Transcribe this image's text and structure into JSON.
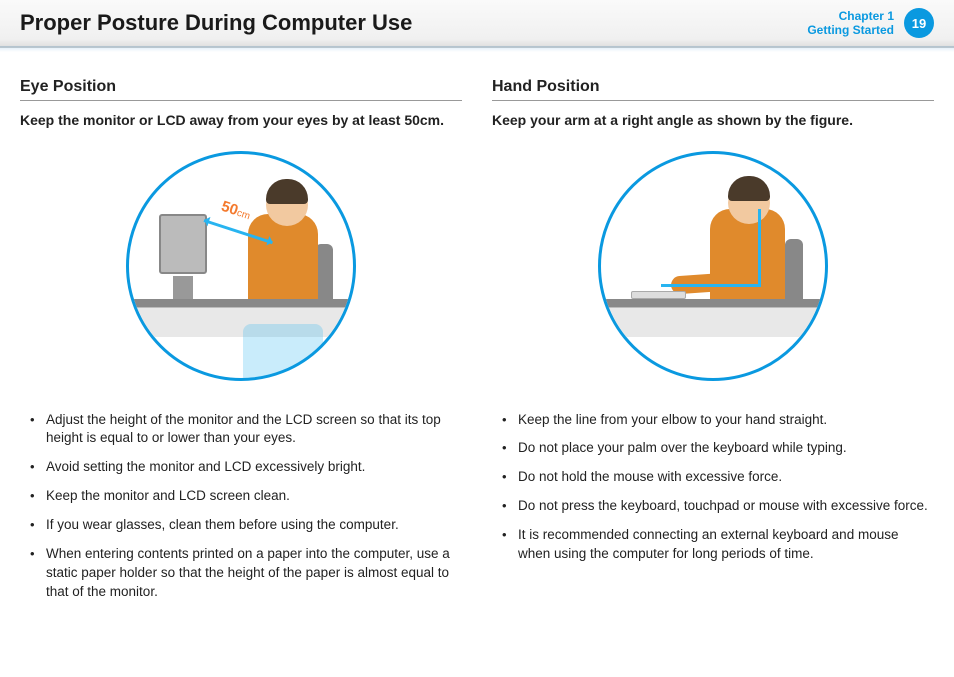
{
  "header": {
    "title": "Proper Posture During Computer Use",
    "chapter_line1": "Chapter 1",
    "chapter_line2": "Getting Started",
    "page_number": "19"
  },
  "left": {
    "title": "Eye Position",
    "intro": "Keep the monitor or LCD away from your eyes by at least 50cm.",
    "distance_label": "50",
    "distance_unit": "cm",
    "bullets": [
      "Adjust the height of the monitor and the LCD screen so that its top height is equal to or lower than your eyes.",
      "Avoid setting the monitor and LCD excessively bright.",
      "Keep the monitor and LCD screen clean.",
      "If you wear glasses, clean them before using the computer.",
      "When entering contents printed on a paper into the computer, use a static paper holder so that the height of the paper is almost equal to that of the monitor."
    ]
  },
  "right": {
    "title": "Hand Position",
    "intro": "Keep your arm at a right angle as shown by the figure.",
    "bullets": [
      "Keep the line from your elbow to your hand straight.",
      "Do not place your palm over the keyboard while typing.",
      "Do not hold the mouse with excessive force.",
      "Do not press the keyboard, touchpad or mouse with excessive force.",
      "It is recommended connecting an external keyboard and mouse when using the computer for long periods of time."
    ]
  }
}
